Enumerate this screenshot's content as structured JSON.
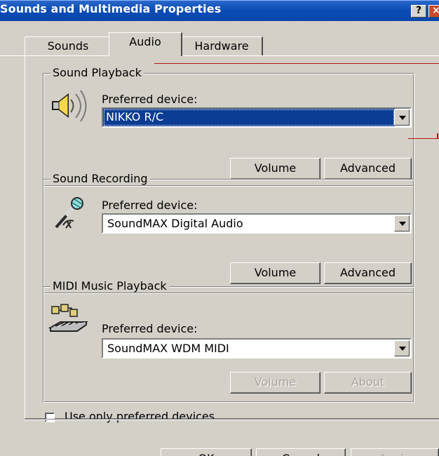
{
  "window": {
    "title": "Sounds and Multimedia Properties",
    "help_button": "?",
    "close_button": "×"
  },
  "tabs": [
    {
      "label": "Sounds",
      "selected": false
    },
    {
      "label": "Audio",
      "selected": true
    },
    {
      "label": "Hardware",
      "selected": false
    }
  ],
  "sound_playback": {
    "title": "Sound Playback",
    "preferred_label": "Preferred device:",
    "selected_device": "NIKKO R/C",
    "volume_button": "Volume",
    "advanced_button": "Advanced"
  },
  "sound_recording": {
    "title": "Sound Recording",
    "preferred_label": "Preferred device:",
    "selected_device": "SoundMAX Digital Audio",
    "volume_button": "Volume",
    "advanced_button": "Advanced"
  },
  "midi_playback": {
    "title": "MIDI Music Playback",
    "preferred_label": "Preferred device:",
    "selected_device": "SoundMAX WDM MIDI",
    "volume_button": "Volume",
    "about_button": "About"
  },
  "options": {
    "preferred_devices_label": "Use only preferred devices",
    "preferred_devices_checked": false
  },
  "footer": {
    "ok_button": "OK",
    "cancel_button": "Cancel",
    "apply_button": "Apply"
  },
  "colors": {
    "titlebar": "#0A4DB7",
    "selection": "#0A3C94",
    "dialog_face": "#D4D0C8",
    "callout_red": "#B71313"
  },
  "icons": {
    "speaker": "speaker-icon",
    "microphone": "microphone-icon",
    "midi": "midi-keyboard-icon"
  }
}
